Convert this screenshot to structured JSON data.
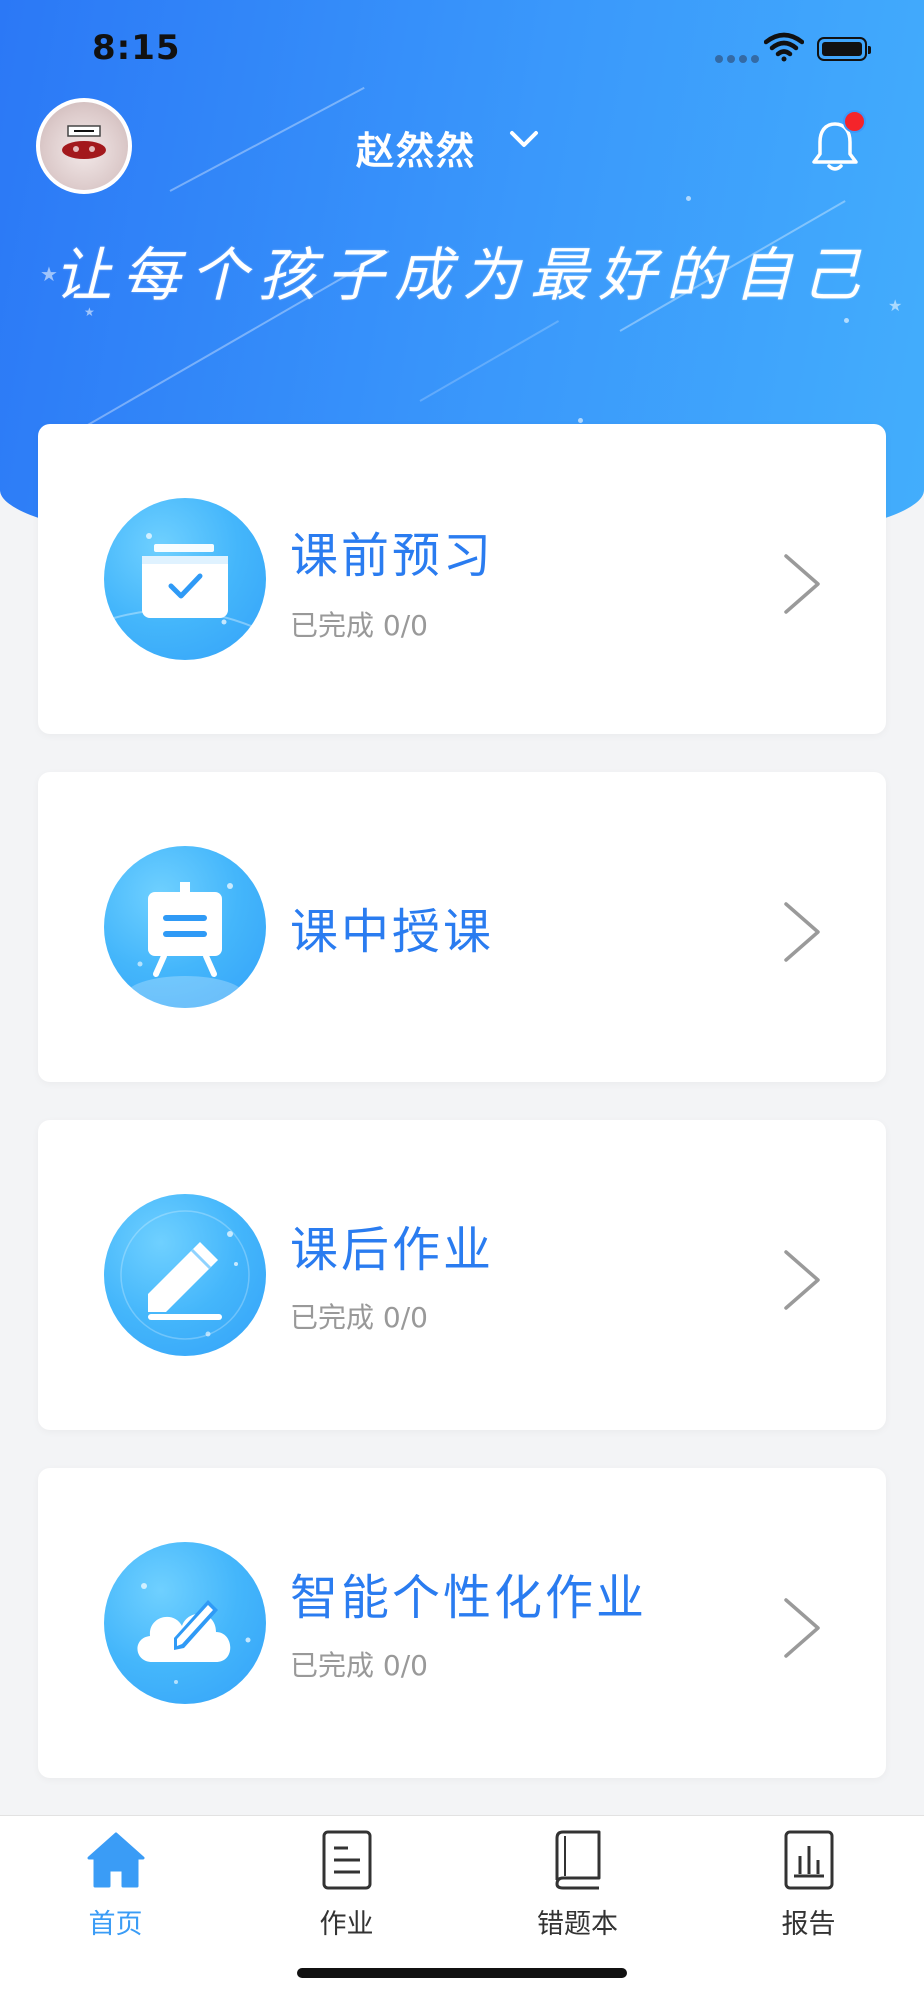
{
  "status_bar": {
    "time": "8:15"
  },
  "header": {
    "user_name": "赵然然",
    "slogan": "让每个孩子成为最好的自己"
  },
  "cards": [
    {
      "title": "课前预习",
      "subtitle": "已完成 0/0",
      "icon": "calendar-check-icon"
    },
    {
      "title": "课中授课",
      "subtitle": "",
      "icon": "easel-board-icon"
    },
    {
      "title": "课后作业",
      "subtitle": "已完成 0/0",
      "icon": "pencil-icon"
    },
    {
      "title": "智能个性化作业",
      "subtitle": "已完成 0/0",
      "icon": "cloud-pencil-icon"
    }
  ],
  "tabs": [
    {
      "label": "首页",
      "icon": "home-icon",
      "active": true
    },
    {
      "label": "作业",
      "icon": "document-icon",
      "active": false
    },
    {
      "label": "错题本",
      "icon": "book-icon",
      "active": false
    },
    {
      "label": "报告",
      "icon": "report-icon",
      "active": false
    }
  ],
  "colors": {
    "header_gradient_start": "#2b78f6",
    "header_gradient_end": "#43aefc",
    "card_title": "#2a7cf0",
    "active_tab": "#3a9cf6",
    "badge": "#f5242a"
  }
}
